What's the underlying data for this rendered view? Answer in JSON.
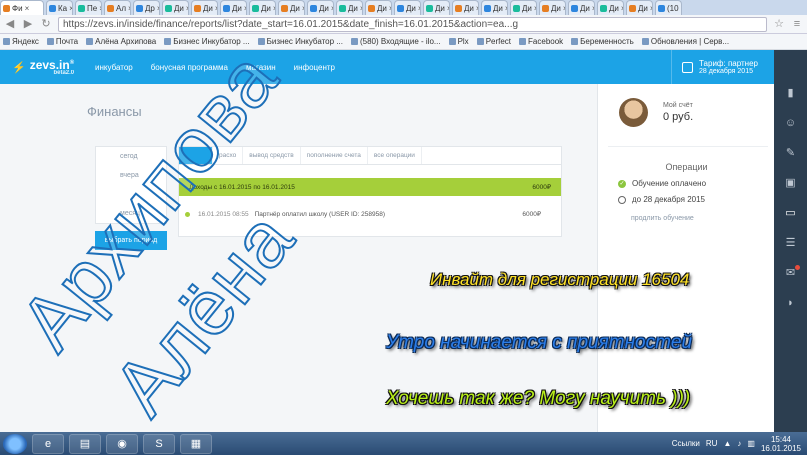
{
  "browser": {
    "tabs": [
      {
        "label": "Фи",
        "active": true
      },
      {
        "label": "Ка"
      },
      {
        "label": "Пе"
      },
      {
        "label": "Ал"
      },
      {
        "label": "Др"
      },
      {
        "label": "Ди"
      },
      {
        "label": "Ди"
      },
      {
        "label": "Ди"
      },
      {
        "label": "Ди"
      },
      {
        "label": "Ди"
      },
      {
        "label": "Ди"
      },
      {
        "label": "Ди"
      },
      {
        "label": "Ди"
      },
      {
        "label": "Ди"
      },
      {
        "label": "Ди"
      },
      {
        "label": "Ди"
      },
      {
        "label": "Ди"
      },
      {
        "label": "Ди"
      },
      {
        "label": "Ди"
      },
      {
        "label": "Ди"
      },
      {
        "label": "Ди"
      },
      {
        "label": "Ди"
      },
      {
        "label": "(10"
      }
    ],
    "url": "https://zevs.in/inside/finance/reports/list?date_start=16.01.2015&date_finish=16.01.2015&action=ea...g",
    "bookmarks": [
      "Яндекс",
      "Почта",
      "Алёна Архипова",
      "Бизнес Инкубатор ...",
      "Бизнес Инкубатор ...",
      "(580) Входящие - ilo...",
      "Plx",
      "Perfect",
      "Facebook",
      "Беременность",
      "Обновления | Серв..."
    ]
  },
  "header": {
    "logo": "zevs.in",
    "logo_sup": "®",
    "logo_sub": "beta2.0",
    "nav": [
      "инкубатор",
      "бонусная программа",
      "магазин",
      "инфоцентр"
    ],
    "tariff_label": "Тариф: партнер",
    "tariff_date": "28 декабря 2015"
  },
  "main": {
    "title": "Финансы",
    "period_items": [
      "сегод",
      "вчера",
      "",
      "месяц"
    ],
    "period_button": "выбрать период",
    "tabs": [
      "",
      "расхо",
      "вывод средств",
      "пополнение счета",
      "все операции"
    ],
    "income_label": "Доходы с 16.01.2015 по 16.01.2015",
    "income_amount": "6000₽",
    "transaction": {
      "date": "16.01.2015 08:55",
      "text": "Партнёр оплатил школу (USER ID: 258958)",
      "amount": "6000₽"
    }
  },
  "side": {
    "account_label": "Мой счёт",
    "account_value": "0 руб.",
    "ops_title": "Операции",
    "op1": "Обучение оплачено",
    "op2": "до 28 декабря 2015",
    "extend": "продлить обучение"
  },
  "overlay": {
    "name1": "Архипова",
    "name2": "Алёна",
    "promo1": "Инвайт для регистрации 16504",
    "promo2": "Утро начинается с приятностей",
    "promo3": "Хочешь так же? Могу научить )))"
  },
  "taskbar": {
    "links": "Ссылки",
    "lang": "RU",
    "time": "15:44",
    "date": "16.01.2015"
  },
  "colors": {
    "brand": "#1ca3e6",
    "income": "#a5cf3a",
    "rail": "#2c3e50"
  }
}
